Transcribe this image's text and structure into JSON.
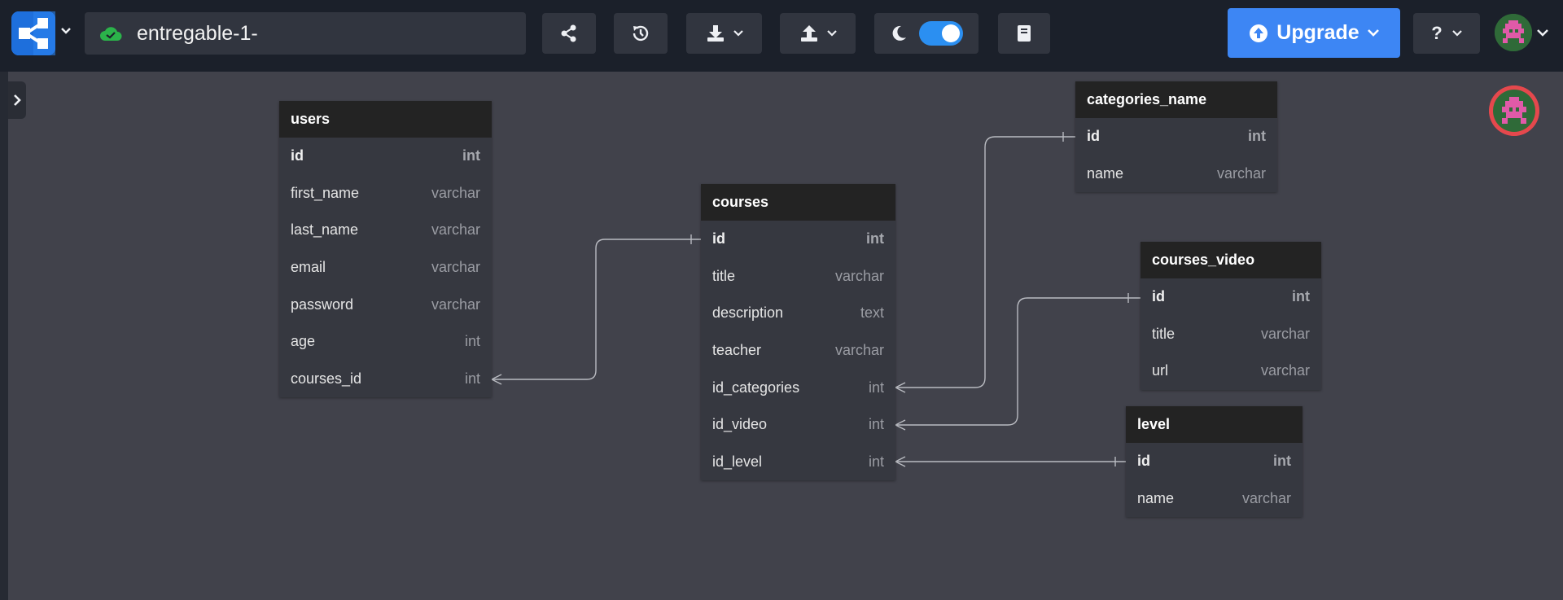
{
  "header": {
    "filename": "entregable-1-",
    "upgrade_label": "Upgrade",
    "help_label": "?"
  },
  "icons": {
    "logo": "diagram-logo-icon",
    "cloud": "cloud-check-icon",
    "share": "share-icon",
    "history": "history-icon",
    "download": "download-icon",
    "upload": "upload-icon",
    "theme": "moon-icon",
    "docs": "book-icon"
  },
  "colors": {
    "accent": "#3d86f4",
    "toggle": "#2b8ff1",
    "cloud": "#2bb34a",
    "avatar_ring": "#e5484d"
  },
  "tables": {
    "users": {
      "name": "users",
      "columns": [
        {
          "name": "id",
          "type": "int"
        },
        {
          "name": "first_name",
          "type": "varchar"
        },
        {
          "name": "last_name",
          "type": "varchar"
        },
        {
          "name": "email",
          "type": "varchar"
        },
        {
          "name": "password",
          "type": "varchar"
        },
        {
          "name": "age",
          "type": "int"
        },
        {
          "name": "courses_id",
          "type": "int"
        }
      ]
    },
    "courses": {
      "name": "courses",
      "columns": [
        {
          "name": "id",
          "type": "int"
        },
        {
          "name": "title",
          "type": "varchar"
        },
        {
          "name": "description",
          "type": "text"
        },
        {
          "name": "teacher",
          "type": "varchar"
        },
        {
          "name": "id_categories",
          "type": "int"
        },
        {
          "name": "id_video",
          "type": "int"
        },
        {
          "name": "id_level",
          "type": "int"
        }
      ]
    },
    "categories_name": {
      "name": "categories_name",
      "columns": [
        {
          "name": "id",
          "type": "int"
        },
        {
          "name": "name",
          "type": "varchar"
        }
      ]
    },
    "courses_video": {
      "name": "courses_video",
      "columns": [
        {
          "name": "id",
          "type": "int"
        },
        {
          "name": "title",
          "type": "varchar"
        },
        {
          "name": "url",
          "type": "varchar"
        }
      ]
    },
    "level": {
      "name": "level",
      "columns": [
        {
          "name": "id",
          "type": "int"
        },
        {
          "name": "name",
          "type": "varchar"
        }
      ]
    }
  }
}
